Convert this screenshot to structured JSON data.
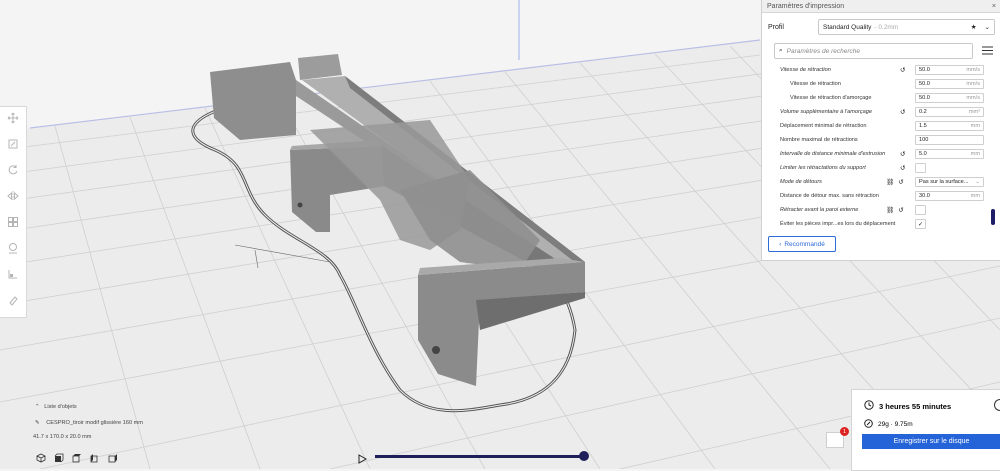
{
  "panel": {
    "title": "Paramètres d'impression",
    "close": "×",
    "profile_label": "Profil",
    "profile_value": "Standard Quality",
    "profile_sub": "- 0.2mm",
    "search_placeholder": "Paramètres de recherche",
    "settings": [
      {
        "label": "Vitesse de rétraction",
        "value": "50.0",
        "unit": "mm/s",
        "italic": true,
        "reset": true
      },
      {
        "label": "Vitesse de rétraction",
        "value": "50.0",
        "unit": "mm/s",
        "indent": true
      },
      {
        "label": "Vitesse de rétraction d'amorçage",
        "value": "50.0",
        "unit": "mm/s",
        "indent": true
      },
      {
        "label": "Volume supplémentaire à l'amorçage",
        "value": "0.2",
        "unit": "mm³",
        "italic": true,
        "reset": true
      },
      {
        "label": "Déplacement minimal de rétraction",
        "value": "1.5",
        "unit": "mm"
      },
      {
        "label": "Nombre maximal de rétractions",
        "value": "100",
        "unit": ""
      },
      {
        "label": "Intervalle de distance minimale d'extrusion",
        "value": "5.0",
        "unit": "mm",
        "italic": true,
        "reset": true
      },
      {
        "label": "Limiter les rétractations du support",
        "checkbox": true,
        "checked": false,
        "italic": true,
        "reset": true
      },
      {
        "label": "Mode de détours",
        "value": "Pas sur la surface...",
        "unit": "⌄",
        "italic": true,
        "link": true,
        "reset": true
      },
      {
        "label": "Distance de détour max. sans rétraction",
        "value": "30.0",
        "unit": "mm"
      },
      {
        "label": "Rétracter avant la paroi externe",
        "checkbox": true,
        "checked": false,
        "italic": true,
        "link": true,
        "reset": true
      },
      {
        "label": "Éviter les pièces impr...es lors du déplacement",
        "checkbox": true,
        "checked": true
      }
    ],
    "recommended_label": "Recommandé"
  },
  "print": {
    "time": "3 heures 55 minutes",
    "material": "29g · 9.75m",
    "save_label": "Enregistrer sur le disque",
    "badge": "1"
  },
  "objects": {
    "header": "Liste d'objets",
    "file_name": "CESPRO_tiroir modif glissière 160 mm",
    "dimensions": "41.7 x 170.0 x 20.0 mm"
  },
  "icons": {
    "left_toolbar": [
      "move-icon",
      "scale-icon",
      "rotate-icon",
      "mirror-icon",
      "per-model-settings-icon",
      "support-blocker-icon",
      "layer-view-icon",
      "eraser-icon"
    ],
    "view_buttons": [
      "3d-view-icon",
      "front-view-icon",
      "top-view-icon",
      "left-view-icon",
      "right-view-icon"
    ]
  },
  "colors": {
    "accent": "#2563d8",
    "slider": "#1e1e5a",
    "grid_line": "#c9c9c9",
    "grid_border": "#8c9ce0",
    "badge": "#dd2222",
    "model": "#8a8a8a"
  },
  "playback": {
    "progress": 1.0
  }
}
